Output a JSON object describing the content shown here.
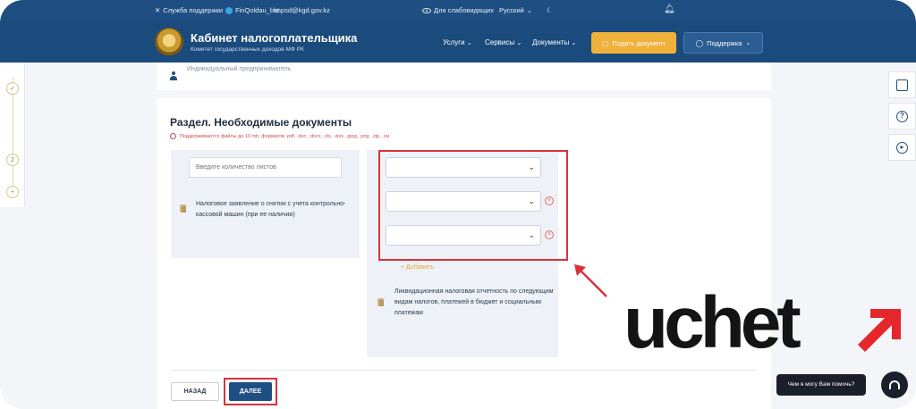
{
  "topbar": {
    "support_label": "Служба поддержки",
    "telegram_bot": "FinQoldau_bot",
    "email": "knpsd@kgd.gov.kz",
    "accessibility_label": "Для слабовидящих",
    "language": "Русский"
  },
  "header": {
    "title": "Кабинет налогоплательщика",
    "subtitle": "Комитет государственных доходов МФ РК",
    "nav": {
      "services": "Услуги",
      "tools": "Сервисы",
      "documents": "Документы"
    },
    "submit_button": "Подать документ",
    "support_button": "Поддержка"
  },
  "stepper": {
    "current_step": "2"
  },
  "summary": {
    "taxpayer_type": "Индивидуальный предприниматель"
  },
  "section": {
    "title": "Раздел. Необходимые документы",
    "hint": "Поддерживаются файлы до 10 mb, форматов .pdf, .doc, .docx, .xls, .xlsx, .jpeg, .png, .zip, .rar"
  },
  "left_panel": {
    "sheets_placeholder": "Введите количество листов",
    "document_label": "Налоговое заявление о снятии с учета контрольно-кассовой машин (при ее наличии)"
  },
  "right_panel": {
    "add_label": "Добавить",
    "document_label": "Ликвидационная налоговая отчетность по следующим видам налогов, платежей в бюджет и социальным платежам"
  },
  "footer": {
    "back_button": "НАЗАД",
    "next_button": "ДАЛЕЕ"
  },
  "chat": {
    "prompt": "Чем я могу Вам помочь?"
  },
  "watermark": {
    "text": "uchet"
  },
  "colors": {
    "header_bg": "#1b4a7d",
    "accent": "#f0b13b",
    "highlight": "#d9323c",
    "watermark_arrow": "#e5262b"
  }
}
